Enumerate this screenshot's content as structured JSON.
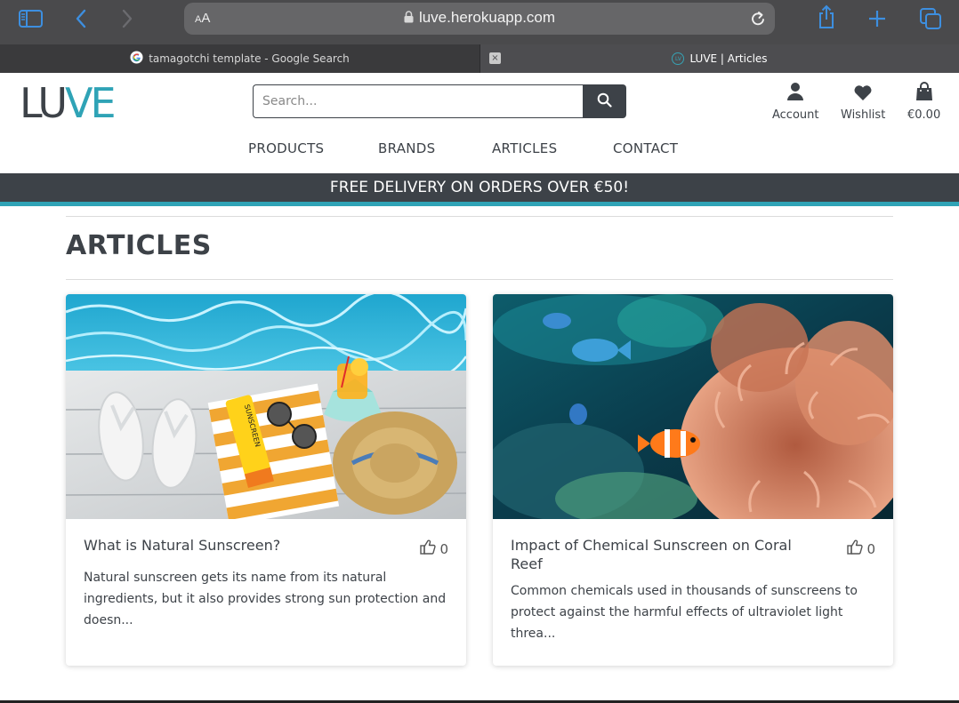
{
  "browser": {
    "aa_label_small": "A",
    "aa_label_big": "A",
    "url": "luve.herokuapp.com",
    "tabs": [
      {
        "title": "tamagotchi template - Google Search",
        "active": false
      },
      {
        "title": "LUVE | Articles",
        "active": true
      }
    ],
    "close_glyph": "×"
  },
  "header": {
    "logo_part1": "LU",
    "logo_part2": "VE",
    "search_placeholder": "Search...",
    "account_label": "Account",
    "wishlist_label": "Wishlist",
    "bag_total": "€0.00"
  },
  "nav": {
    "items": [
      "PRODUCTS",
      "BRANDS",
      "ARTICLES",
      "CONTACT"
    ]
  },
  "banner": {
    "text": "FREE DELIVERY ON ORDERS OVER €50!"
  },
  "page": {
    "title": "ARTICLES"
  },
  "articles": [
    {
      "title": "What is Natural Sunscreen?",
      "likes": "0",
      "excerpt": "Natural sunscreen gets its name from its natural ingredients, but it also provides strong sun protection and doesn...",
      "product_text": "SUNSCREEN"
    },
    {
      "title": "Impact of Chemical Sunscreen on Coral Reef",
      "likes": "0",
      "excerpt": "Common chemicals used in thousands of sunscreens to protect against the harmful effects of ultraviolet light threa..."
    }
  ],
  "colors": {
    "brand_dark": "#3d4248",
    "brand_teal": "#2fa3b6",
    "browser_bar": "#4a4a4c",
    "safari_blue": "#3d8fe0"
  },
  "icons": {
    "sidebar": "sidebar-icon",
    "back": "chevron-left-icon",
    "forward": "chevron-right-icon",
    "lock": "lock-icon",
    "reload": "reload-icon",
    "share": "share-icon",
    "new_tab": "plus-icon",
    "tabs": "tabs-overview-icon",
    "search": "search-icon",
    "account": "user-icon",
    "wishlist": "heart-icon",
    "bag": "shopping-bag-icon",
    "like": "thumbs-up-icon"
  }
}
